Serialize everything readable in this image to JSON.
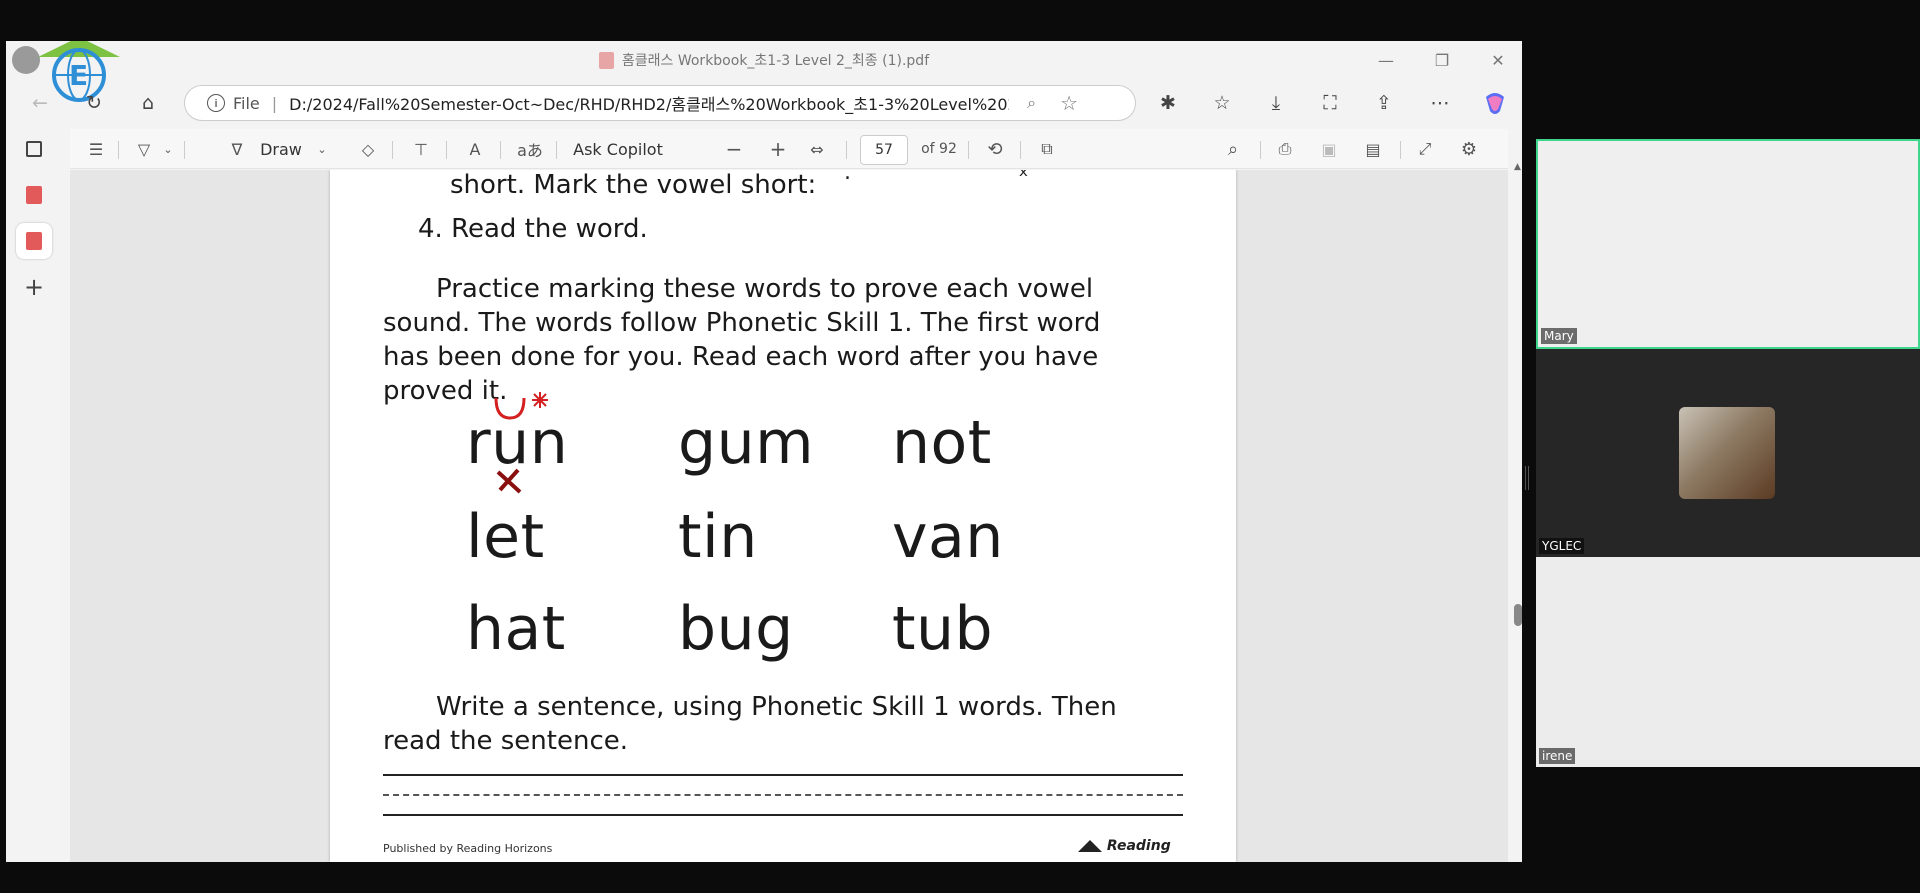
{
  "browser": {
    "title": "홈클래스 Workbook_초1-3 Level 2_최종 (1).pdf",
    "address_prefix": "File",
    "address": "D:/2024/Fall%20Semester-Oct~Dec/RHD/RHD2/홈클래스%20Workbook_초1-3%20Level%202..."
  },
  "pdf_toolbar": {
    "draw_label": "Draw",
    "ask_copilot_label": "Ask Copilot",
    "page_number": "57",
    "page_total": "of 92",
    "read_aloud_label": "A",
    "translate_label": "aあ"
  },
  "document": {
    "line_top": "short. Mark the vowel short:",
    "step4": "4. Read the word.",
    "para1": [
      "Practice marking these words to prove each vowel",
      "sound. The words follow Phonetic Skill 1. The first word",
      "has been done for you. Read each word after you have",
      "proved it."
    ],
    "words": [
      [
        "run",
        "gum",
        "not"
      ],
      [
        "let",
        "tin",
        "van"
      ],
      [
        "hat",
        "bug",
        "tub"
      ]
    ],
    "para2": [
      "Write a sentence, using Phonetic Skill 1 words. Then",
      "read the sentence."
    ],
    "footer_left": "Published by Reading Horizons",
    "footer_logo": "Reading"
  },
  "participants": [
    {
      "name": "Mary",
      "active": true
    },
    {
      "name": "YGLEC",
      "active": false
    },
    {
      "name": "irene",
      "active": false
    }
  ],
  "colors": {
    "accent_border": "#3dd68c",
    "annotation_red": "#d42020"
  }
}
